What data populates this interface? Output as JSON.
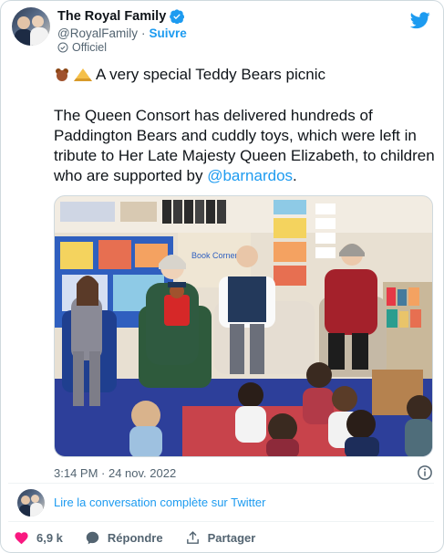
{
  "author": {
    "name": "The Royal Family",
    "handle": "@RoyalFamily",
    "separator": "·",
    "follow_label": "Suivre",
    "official_label": "Officiel"
  },
  "tweet": {
    "headline": "A very special Teddy Bears picnic",
    "body_before_mention": "The Queen Consort has delivered hundreds of Paddington Bears and cuddly toys, which were left in tribute to Her Late Majesty Queen Elizabeth, to children who are supported by ",
    "mention": "@barnardos",
    "body_after_mention": ".",
    "timestamp": "3:14 PM · 24 nov. 2022"
  },
  "photo": {
    "sign_text": "Book Corner"
  },
  "footer": {
    "read_more_label": "Lire la conversation complète sur Twitter",
    "like_count": "6,9 k",
    "reply_label": "Répondre",
    "share_label": "Partager"
  },
  "colors": {
    "accent": "#1d9bf0",
    "like": "#f91880",
    "text_secondary": "#536471"
  }
}
